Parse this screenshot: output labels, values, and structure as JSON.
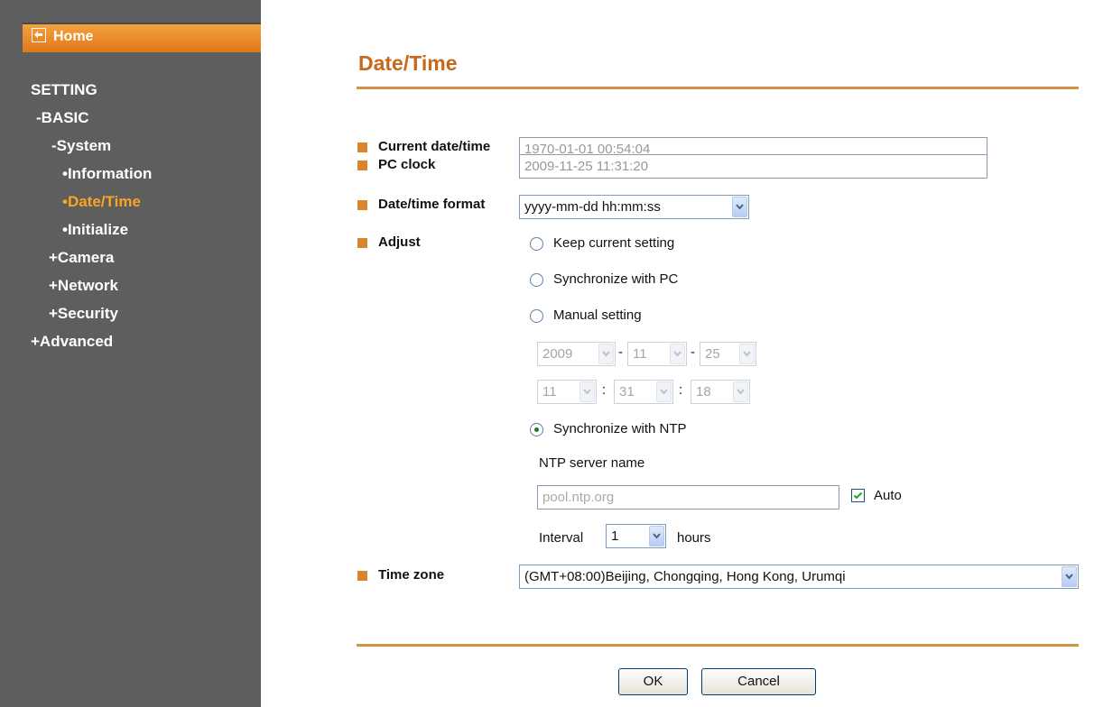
{
  "sidebar": {
    "home": "Home",
    "items": [
      {
        "label": "SETTING"
      },
      {
        "label": "-BASIC"
      },
      {
        "label": "-System"
      },
      {
        "label": "•Information"
      },
      {
        "label": "•Date/Time"
      },
      {
        "label": "•Initialize"
      },
      {
        "label": "+Camera"
      },
      {
        "label": "+Network"
      },
      {
        "label": "+Security"
      },
      {
        "label": "+Advanced"
      }
    ]
  },
  "page": {
    "title": "Date/Time"
  },
  "form": {
    "current_label": "Current date/time",
    "current_value": "1970-01-01   00:54:04",
    "pc_label": "PC clock",
    "pc_value": "2009-11-25   11:31:20",
    "format_label": "Date/time format",
    "format_value": "yyyy-mm-dd hh:mm:ss",
    "adjust_label": "Adjust",
    "adjust_options": [
      "Keep current setting",
      "Synchronize with PC",
      "Manual setting",
      "Synchronize with NTP"
    ],
    "selected_option": "Synchronize with NTP",
    "manual": {
      "year": "2009",
      "month": "11",
      "day": "25",
      "hour": "11",
      "minute": "31",
      "second": "18",
      "date_sep": "-",
      "time_sep": ":"
    },
    "ntp_label": "NTP server name",
    "ntp_value": "pool.ntp.org",
    "auto_label": "Auto",
    "auto_checked": true,
    "interval_label": "Interval",
    "interval_value": "1",
    "interval_unit": "hours",
    "timezone_label": "Time zone",
    "timezone_value": "(GMT+08:00)Beijing, Chongqing, Hong Kong, Urumqi"
  },
  "buttons": {
    "ok": "OK",
    "cancel": "Cancel"
  },
  "colors": {
    "accent": "#d9852b",
    "title": "#c7681a",
    "sidebar": "#5e5e5e",
    "active_nav": "#f6a623"
  }
}
